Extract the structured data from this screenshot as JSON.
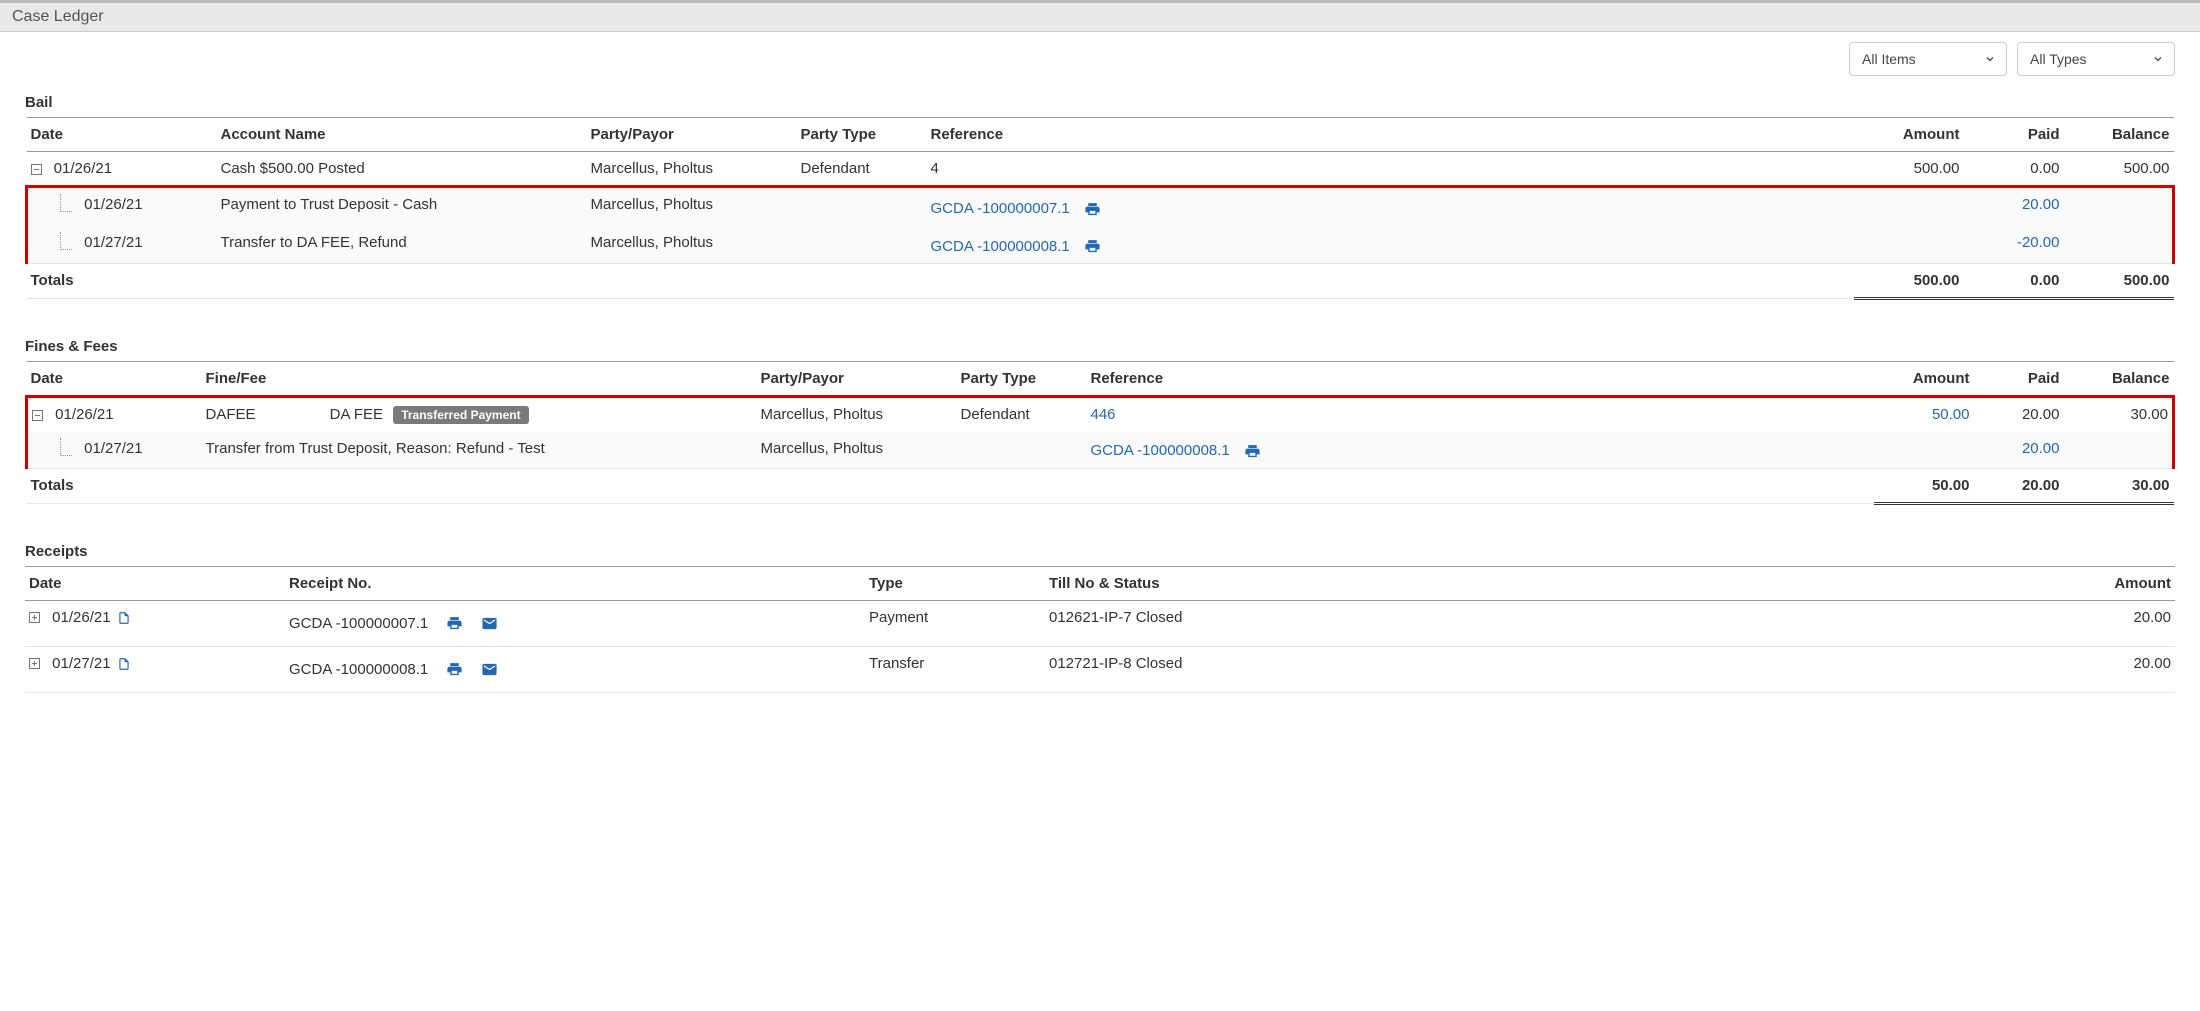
{
  "header": {
    "title": "Case Ledger"
  },
  "filters": {
    "items_label": "All Items",
    "types_label": "All Types"
  },
  "bail": {
    "title": "Bail",
    "columns": {
      "date": "Date",
      "account": "Account Name",
      "party": "Party/Payor",
      "party_type": "Party Type",
      "reference": "Reference",
      "amount": "Amount",
      "paid": "Paid",
      "balance": "Balance"
    },
    "rows": [
      {
        "date": "01/26/21",
        "account": "Cash $500.00 Posted",
        "party": "Marcellus, Pholtus",
        "party_type": "Defendant",
        "reference": "4",
        "amount": "500.00",
        "paid": "0.00",
        "balance": "500.00"
      }
    ],
    "sub_rows": [
      {
        "date": "01/26/21",
        "account": "Payment to Trust Deposit - Cash",
        "party": "Marcellus, Pholtus",
        "reference": "GCDA -100000007.1",
        "paid": "20.00"
      },
      {
        "date": "01/27/21",
        "account": "Transfer to DA FEE, Refund",
        "party": "Marcellus, Pholtus",
        "reference": "GCDA -100000008.1",
        "paid": "-20.00"
      }
    ],
    "totals": {
      "label": "Totals",
      "amount": "500.00",
      "paid": "0.00",
      "balance": "500.00"
    }
  },
  "fines": {
    "title": "Fines & Fees",
    "columns": {
      "date": "Date",
      "finefee": "Fine/Fee",
      "party": "Party/Payor",
      "party_type": "Party Type",
      "reference": "Reference",
      "amount": "Amount",
      "paid": "Paid",
      "balance": "Balance"
    },
    "rows": [
      {
        "date": "01/26/21",
        "code": "DAFEE",
        "desc": "DA FEE",
        "badge": "Transferred Payment",
        "party": "Marcellus, Pholtus",
        "party_type": "Defendant",
        "reference": "446",
        "amount": "50.00",
        "paid": "20.00",
        "balance": "30.00"
      }
    ],
    "sub_rows": [
      {
        "date": "01/27/21",
        "desc": "Transfer from Trust Deposit, Reason: Refund - Test",
        "party": "Marcellus, Pholtus",
        "reference": "GCDA -100000008.1",
        "paid": "20.00"
      }
    ],
    "totals": {
      "label": "Totals",
      "amount": "50.00",
      "paid": "20.00",
      "balance": "30.00"
    }
  },
  "receipts": {
    "title": "Receipts",
    "columns": {
      "date": "Date",
      "receipt_no": "Receipt No.",
      "type": "Type",
      "till": "Till No & Status",
      "amount": "Amount"
    },
    "rows": [
      {
        "date": "01/26/21",
        "receipt_no": "GCDA -100000007.1",
        "type": "Payment",
        "till": "012621-IP-7 Closed",
        "amount": "20.00"
      },
      {
        "date": "01/27/21",
        "receipt_no": "GCDA -100000008.1",
        "type": "Transfer",
        "till": "012721-IP-8 Closed",
        "amount": "20.00"
      }
    ]
  }
}
